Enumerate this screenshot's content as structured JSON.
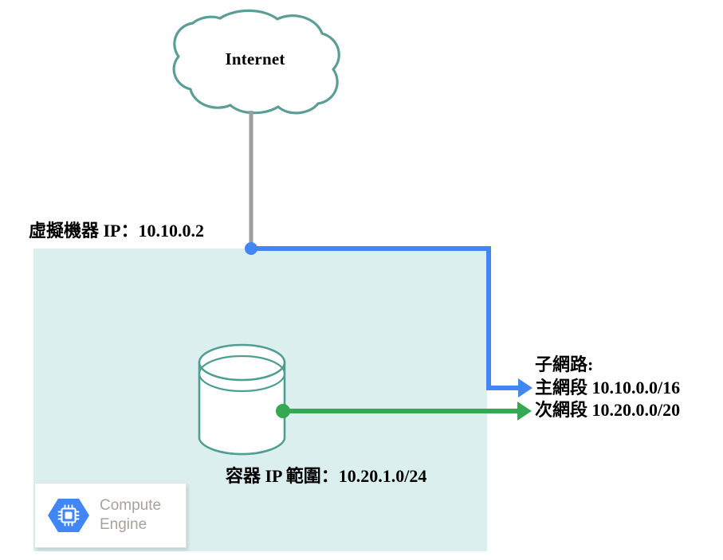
{
  "diagram": {
    "cloud": {
      "label": "Internet",
      "icon": "cloud-icon",
      "outline_color": "#5a9e96"
    },
    "vm": {
      "ip_label": "虛擬機器 IP：10.10.0.2",
      "connector_color": "#4285f4"
    },
    "container": {
      "ip_range_label": "容器 IP 範圍：10.20.1.0/24",
      "icon": "database-cylinder-icon",
      "outline_color": "#4f9e92",
      "connector_color": "#34a853"
    },
    "subnet": {
      "title": "子網路:",
      "primary_range": "主網段 10.10.0.0/16",
      "secondary_range": "次網段 10.20.0.0/20"
    },
    "vpc_region": {
      "fill_color": "#dcefef"
    },
    "compute_engine": {
      "title": "Compute\nEngine",
      "icon": "compute-engine-hexagon-icon",
      "icon_color": "#4285f4",
      "text_color": "#a8a29b"
    },
    "links": {
      "internet_to_vm_color": "#9e9e9e",
      "vm_to_subnet_color": "#4285f4",
      "container_to_subnet_color": "#34a853"
    }
  }
}
